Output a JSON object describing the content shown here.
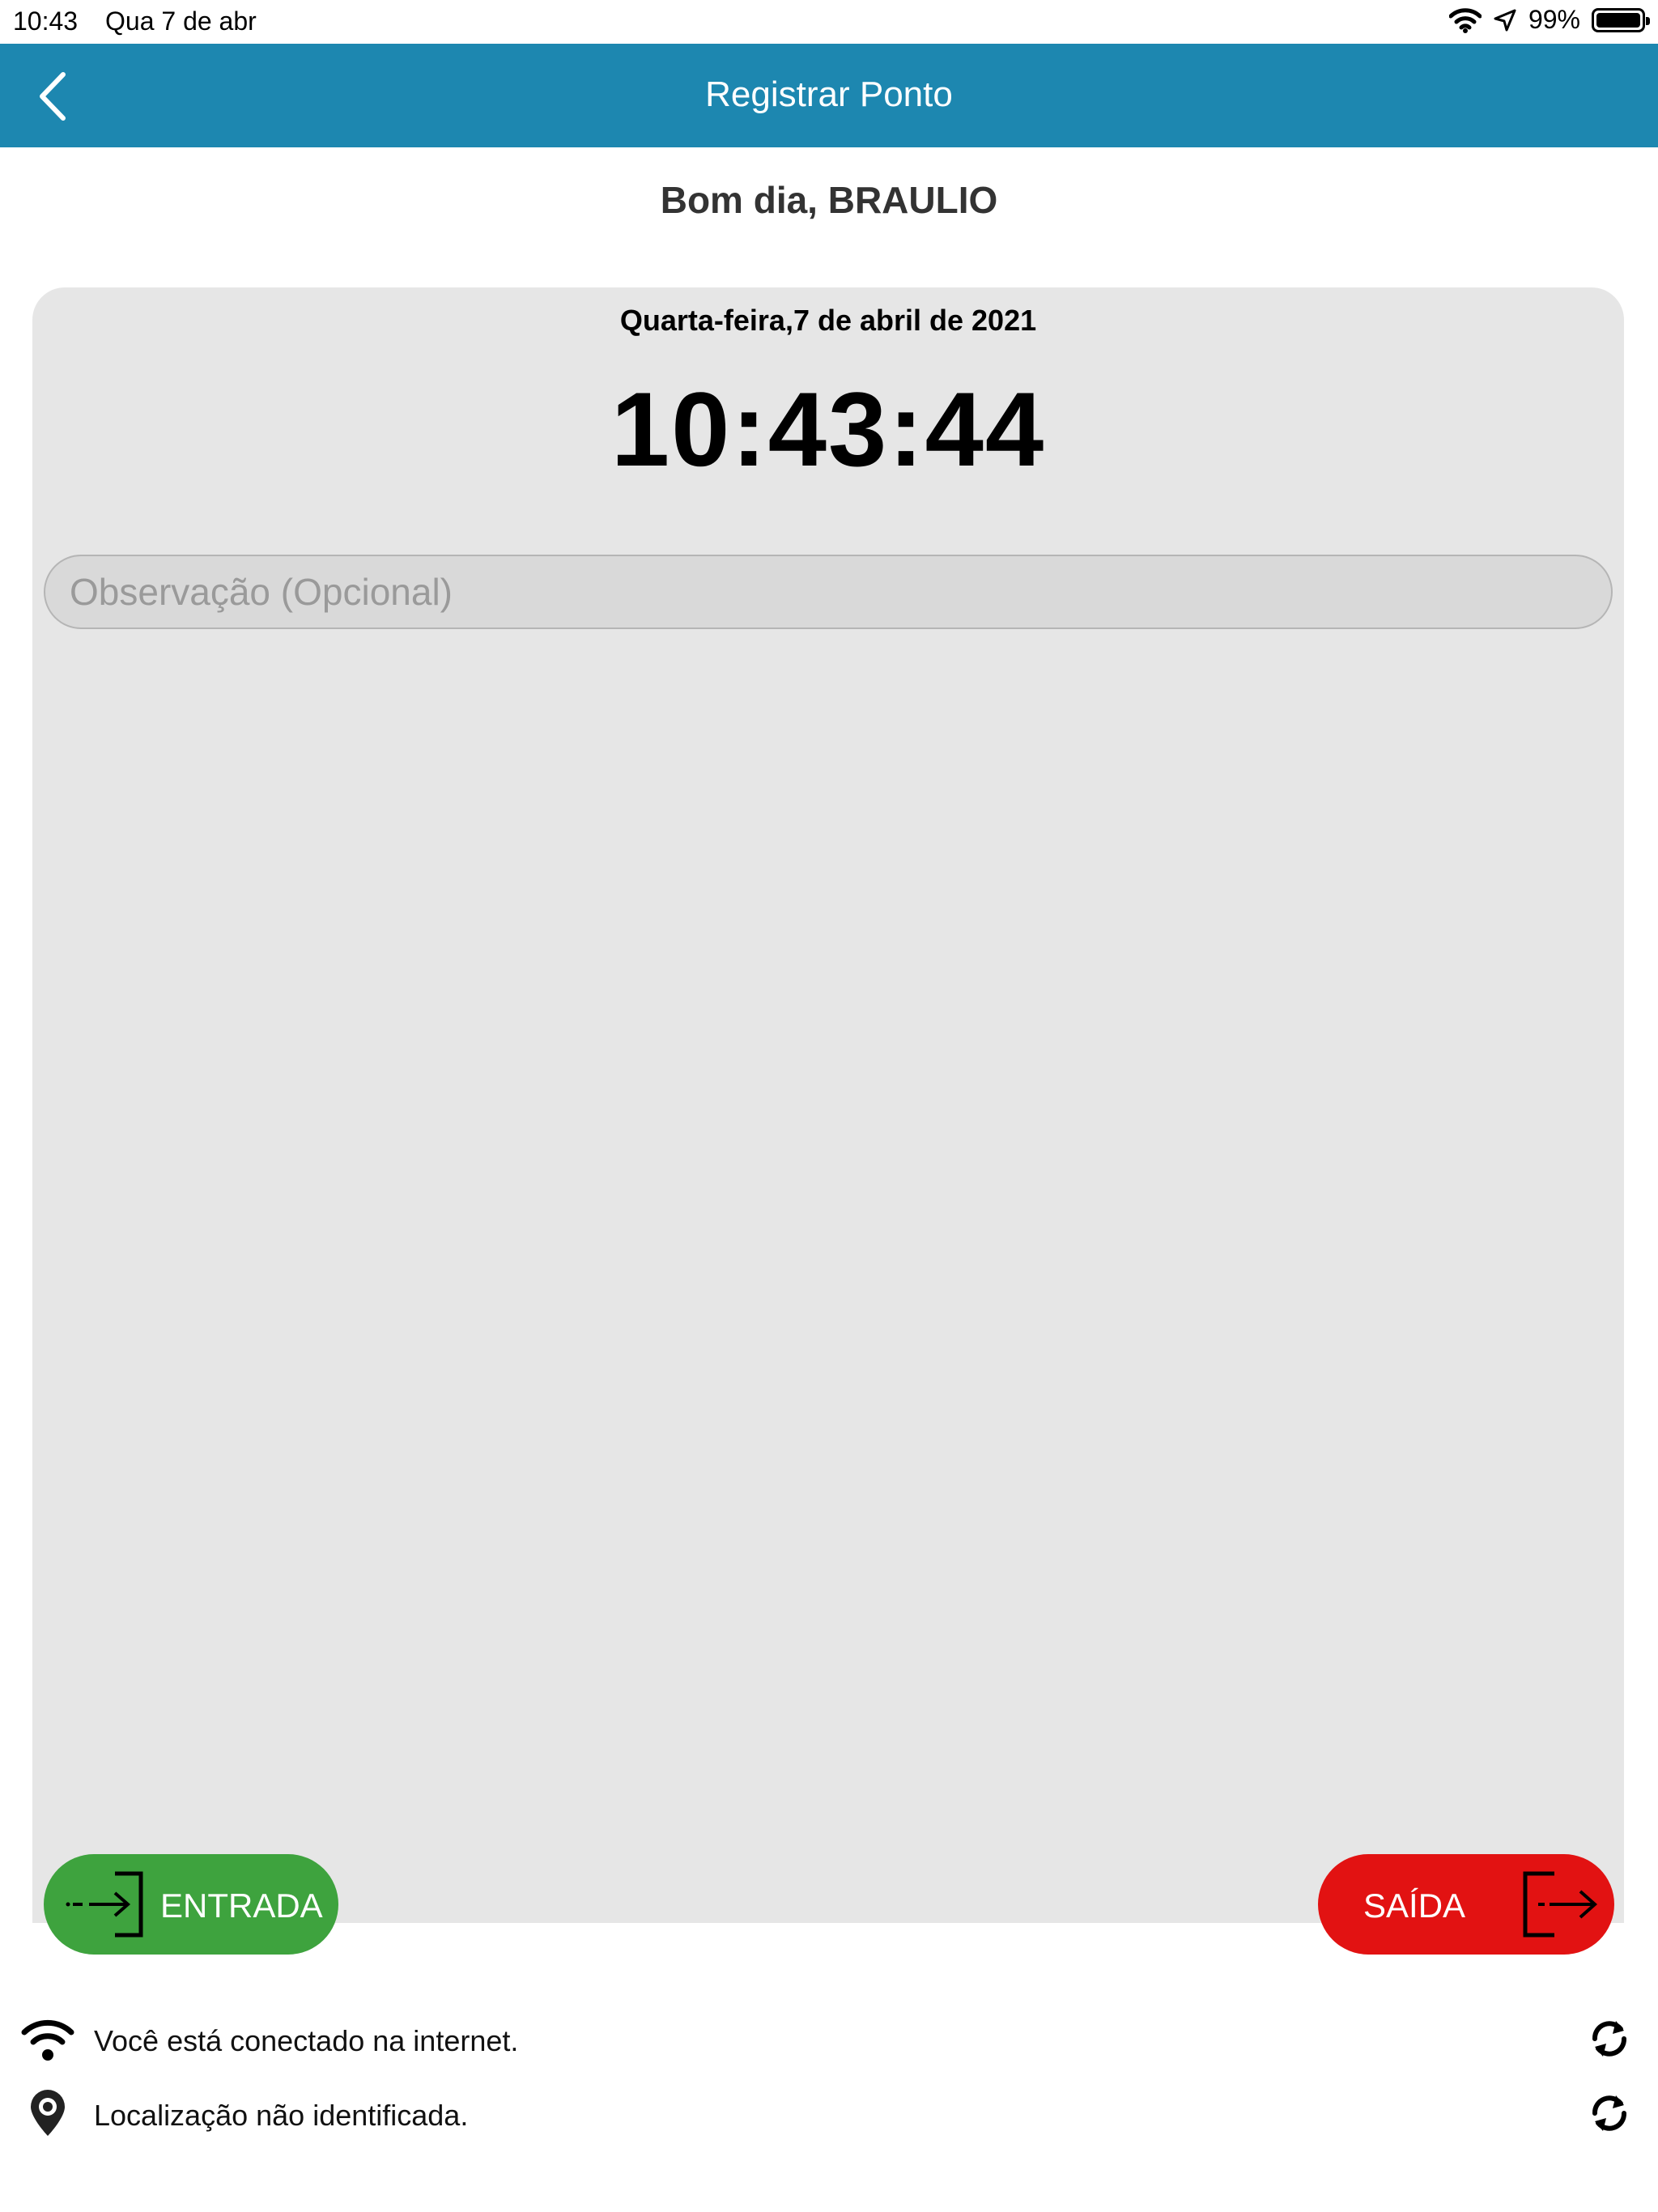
{
  "status_bar": {
    "time": "10:43",
    "date": "Qua 7 de abr",
    "battery": "99%",
    "icons": [
      "wifi-icon",
      "location-arrow-icon",
      "battery-icon"
    ]
  },
  "nav": {
    "title": "Registrar Ponto",
    "back_icon": "chevron-left-icon"
  },
  "greeting": "Bom dia, BRAULIO",
  "clock_card": {
    "date": "Quarta-feira,7 de abril de 2021",
    "time": "10:43:44",
    "observation_placeholder": "Observação (Opcional)",
    "observation_value": ""
  },
  "actions": {
    "entrada_label": "ENTRADA",
    "saida_label": "SAÍDA"
  },
  "status": {
    "internet": "Você está conectado na internet.",
    "location": "Localização não identificada."
  },
  "colors": {
    "nav": "#1d87b0",
    "card": "#e6e6e6",
    "entrada": "#3ea33e",
    "saida": "#e21212"
  }
}
